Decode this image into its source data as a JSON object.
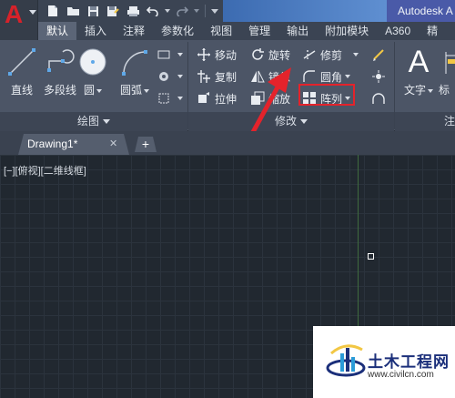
{
  "app": {
    "title": "Autodesk A",
    "logo_letter": "A"
  },
  "quick_access": [
    "new-icon",
    "open-icon",
    "save-icon",
    "saveas-icon",
    "print-icon",
    "undo-icon",
    "redo-icon"
  ],
  "ribbon_tabs": [
    {
      "label": "默认",
      "active": true
    },
    {
      "label": "插入",
      "active": false
    },
    {
      "label": "注释",
      "active": false
    },
    {
      "label": "参数化",
      "active": false
    },
    {
      "label": "视图",
      "active": false
    },
    {
      "label": "管理",
      "active": false
    },
    {
      "label": "输出",
      "active": false
    },
    {
      "label": "附加模块",
      "active": false
    },
    {
      "label": "A360",
      "active": false
    },
    {
      "label": "精",
      "active": false
    }
  ],
  "draw_panel": {
    "title": "绘图",
    "buttons": [
      {
        "label": "直线"
      },
      {
        "label": "多段线"
      },
      {
        "label": "圆"
      },
      {
        "label": "圆弧"
      }
    ]
  },
  "modify_panel": {
    "title": "修改",
    "rows": [
      [
        {
          "label": "移动"
        },
        {
          "label": "旋转"
        },
        {
          "label": "修剪"
        }
      ],
      [
        {
          "label": "复制"
        },
        {
          "label": "镜像"
        },
        {
          "label": "圆角"
        }
      ],
      [
        {
          "label": "拉伸"
        },
        {
          "label": "缩放"
        },
        {
          "label": "阵列"
        }
      ]
    ]
  },
  "annotation_panel": {
    "text_button": "文字",
    "partial_button": "标",
    "partial_title": "注"
  },
  "document": {
    "tab_label": "Drawing1*",
    "close_glyph": "✕",
    "add_glyph": "+"
  },
  "canvas": {
    "viewport_label": "[−][俯视][二维线框]"
  },
  "watermark": {
    "title": "土木工程网",
    "url": "www.civilcn.com"
  },
  "colors": {
    "highlight": "#e4232b",
    "arrow": "#e4232b",
    "app_red": "#d6222a"
  }
}
